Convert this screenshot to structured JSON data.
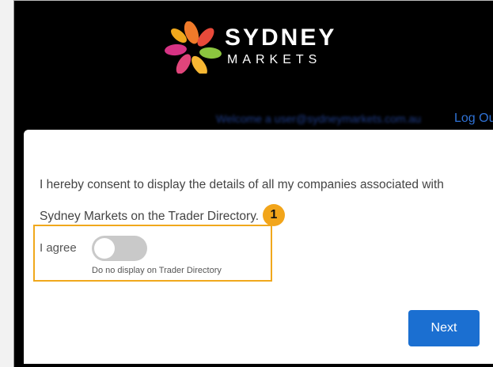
{
  "header": {
    "logo_word": "SYDNEY",
    "logo_sub": "MARKETS",
    "welcome_text": "Welcome a user@sydneymarkets.com.au",
    "logout_label": "Log Out"
  },
  "consent": {
    "text": "I hereby consent to display the details of all my companies associated with Sydney Markets on the Trader Directory.",
    "callout_number": "1",
    "agree_label": "I agree",
    "toggle_state": "off",
    "toggle_caption": "Do no display on Trader Directory",
    "next_label": "Next"
  },
  "colors": {
    "page_bg": "#000000",
    "link": "#2f72d6",
    "primary_button": "#1b6fd1",
    "highlight": "#f0a81c"
  },
  "icons": [
    "sydney-markets-leaf-logo-icon"
  ]
}
